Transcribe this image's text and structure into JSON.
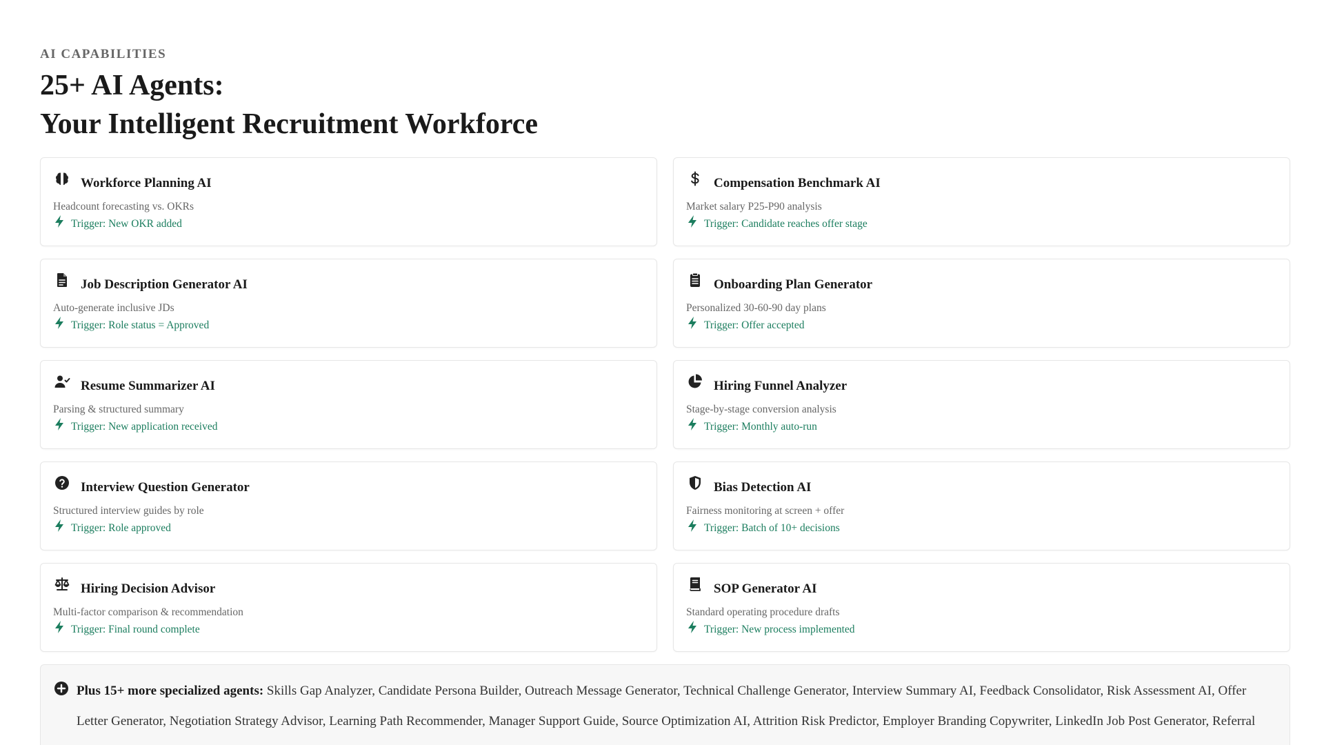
{
  "header": {
    "eyebrow": "AI CAPABILITIES",
    "title_line1": "25+ AI Agents:",
    "title_line2": "Your Intelligent Recruitment Workforce"
  },
  "colors": {
    "trigger": "#1b7d5e",
    "title": "#1a1a1a",
    "muted": "#666666"
  },
  "agents": [
    {
      "icon": "brain-icon",
      "title": "Workforce Planning AI",
      "desc": "Headcount forecasting vs. OKRs",
      "trigger": "Trigger: New OKR added"
    },
    {
      "icon": "dollar-icon",
      "title": "Compensation Benchmark AI",
      "desc": "Market salary P25-P90 analysis",
      "trigger": "Trigger: Candidate reaches offer stage"
    },
    {
      "icon": "document-icon",
      "title": "Job Description Generator AI",
      "desc": "Auto-generate inclusive JDs",
      "trigger": "Trigger: Role status = Approved"
    },
    {
      "icon": "clipboard-icon",
      "title": "Onboarding Plan Generator",
      "desc": "Personalized 30-60-90 day plans",
      "trigger": "Trigger: Offer accepted"
    },
    {
      "icon": "user-check-icon",
      "title": "Resume Summarizer AI",
      "desc": "Parsing & structured summary",
      "trigger": "Trigger: New application received"
    },
    {
      "icon": "pie-chart-icon",
      "title": "Hiring Funnel Analyzer",
      "desc": "Stage-by-stage conversion analysis",
      "trigger": "Trigger: Monthly auto-run"
    },
    {
      "icon": "question-icon",
      "title": "Interview Question Generator",
      "desc": "Structured interview guides by role",
      "trigger": "Trigger: Role approved"
    },
    {
      "icon": "shield-icon",
      "title": "Bias Detection AI",
      "desc": "Fairness monitoring at screen + offer",
      "trigger": "Trigger: Batch of 10+ decisions"
    },
    {
      "icon": "scale-icon",
      "title": "Hiring Decision Advisor",
      "desc": "Multi-factor comparison & recommendation",
      "trigger": "Trigger: Final round complete"
    },
    {
      "icon": "book-icon",
      "title": "SOP Generator AI",
      "desc": "Standard operating procedure drafts",
      "trigger": "Trigger: New process implemented"
    }
  ],
  "more": {
    "icon": "plus-circle-icon",
    "label": "Plus 15+ more specialized agents:",
    "text": "Skills Gap Analyzer, Candidate Persona Builder, Outreach Message Generator, Technical Challenge Generator, Interview Summary AI, Feedback Consolidator, Risk Assessment AI, Offer Letter Generator, Negotiation Strategy Advisor, Learning Path Recommender, Manager Support Guide, Source Optimization AI, Attrition Risk Predictor, Employer Branding Copywriter, LinkedIn Job Post Generator, Referral Program Optimizer, Fairness Scoring AI, Regulatory Compliance Analyzer, Policy Simplifier AI, Meeting Notes Converter"
  }
}
